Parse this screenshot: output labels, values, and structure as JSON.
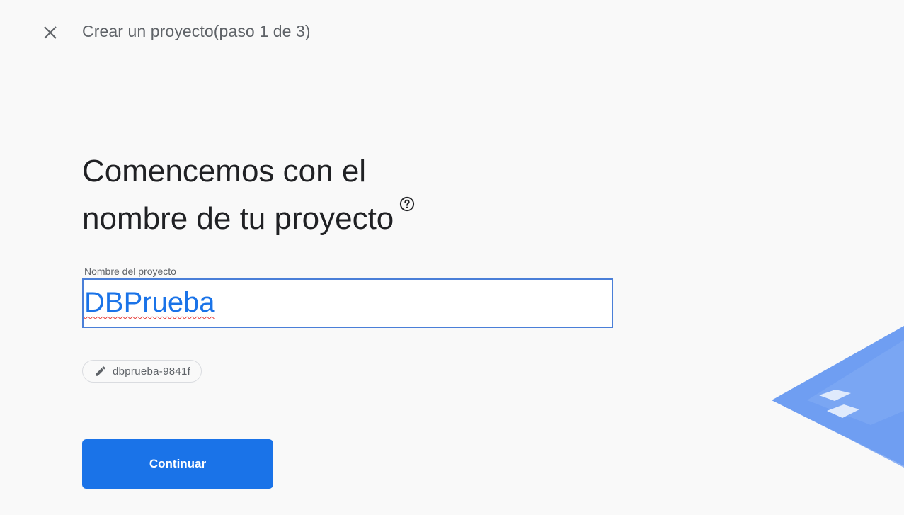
{
  "header": {
    "close_icon": "close-icon",
    "step_title": "Crear un proyecto(paso 1 de 3)"
  },
  "main": {
    "heading_line1": "Comencemos con el",
    "heading_line2": "nombre de tu proyecto",
    "help_icon": "help-circle-icon",
    "project_name_label": "Nombre del proyecto",
    "project_name_value": "DBPrueba",
    "project_id_icon": "edit-pencil-icon",
    "project_id": "dbprueba-9841f",
    "continue_label": "Continuar"
  },
  "colors": {
    "primary": "#1a73e8",
    "text_dark": "#202124",
    "text_muted": "#5f6368",
    "background": "#f9f9f9"
  }
}
